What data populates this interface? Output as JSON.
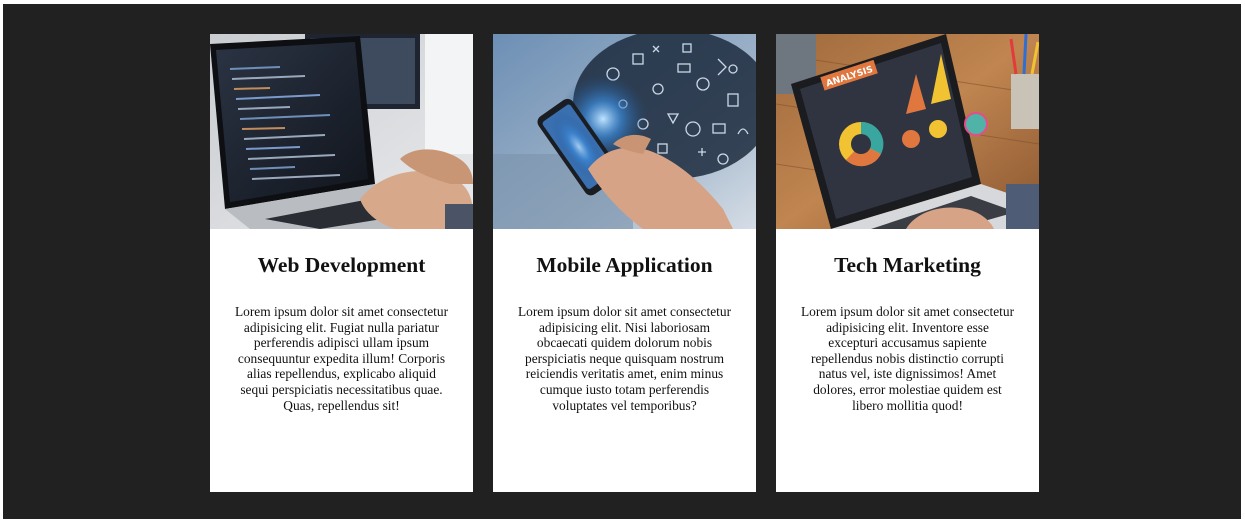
{
  "cards": [
    {
      "image": "laptop-coding-photo",
      "title": "Web Development",
      "text": "Lorem ipsum dolor sit amet consectetur adipisicing elit. Fugiat nulla pariatur perferendis adipisci ullam ipsum consequuntur expedita illum! Corporis alias repellendus, explicabo aliquid sequi perspiciatis necessitatibus quae. Quas, repellendus sit!"
    },
    {
      "image": "smartphone-hand-photo",
      "title": "Mobile Application",
      "text": "Lorem ipsum dolor sit amet consectetur adipisicing elit. Nisi laboriosam obcaecati quidem dolorum nobis perspiciatis neque quisquam nostrum reiciendis veritatis amet, enim minus cumque iusto totam perferendis voluptates vel temporibus?"
    },
    {
      "image": "laptop-analytics-photo",
      "title": "Tech Marketing",
      "analysis_label": "ANALYSIS",
      "text": "Lorem ipsum dolor sit amet consectetur adipisicing elit. Inventore esse excepturi accusamus sapiente repellendus nobis distinctio corrupti natus vel, iste dignissimos! Amet dolores, error molestiae quidem est libero mollitia quod!"
    }
  ]
}
